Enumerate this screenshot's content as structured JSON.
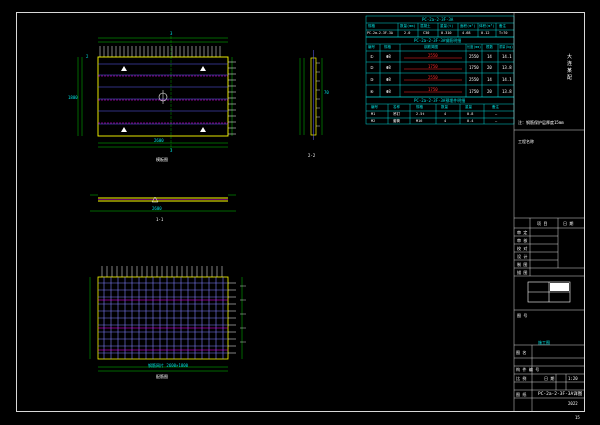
{
  "drawing": {
    "colors": {
      "background": "#000000",
      "frame": "#d8d8d8",
      "cyan": "#00e5e5",
      "yellow": "#ffff00",
      "green": "#00ff00",
      "blue": "#4040ff",
      "magenta": "#ff00ff",
      "red": "#ff2a2a",
      "white": "#ffffff"
    },
    "top_view": {
      "dim_top": "3",
      "dim_left": "2",
      "dim_bottom": "3",
      "dim_width": "2600",
      "dim_height": "1800",
      "caption": "模板图"
    },
    "side_view": {
      "caption": "2-2",
      "dim": "70"
    },
    "section_view": {
      "caption": "1-1",
      "dim": "2600"
    },
    "rebar_view": {
      "caption": "配筋图",
      "inner_label": "钢筋网片 2600×1800"
    },
    "summary_table": {
      "title": "PC-2a-2-3F-3A",
      "headers": [
        "规格",
        "数量(mm)",
        "混凝土",
        "重量(t)",
        "面积(m²)",
        "体积(m³)",
        "备注"
      ],
      "row": [
        "PC-2a-2-3F-3A",
        "2.0",
        "C30",
        "0.310",
        "4.68",
        "0.12",
        "T=70"
      ]
    },
    "rebar_table": {
      "title": "PC-2a-2-3F-3A钢筋明细",
      "headers": [
        "编号",
        "规格",
        "钢筋简图",
        "长度(mm)",
        "根数",
        "重量(kg)"
      ],
      "rows": [
        {
          "no": "①",
          "spec": "Φ8",
          "shape": "2550",
          "len": "2550",
          "count": "14",
          "weight": "14.1"
        },
        {
          "no": "②",
          "spec": "Φ8",
          "shape": "1750",
          "len": "1750",
          "count": "20",
          "weight": "13.8"
        },
        {
          "no": "③",
          "spec": "Φ8",
          "shape": "2550",
          "len": "2550",
          "count": "14",
          "weight": "14.1"
        },
        {
          "no": "④",
          "spec": "Φ8",
          "shape": "1750",
          "len": "1750",
          "count": "20",
          "weight": "13.8"
        }
      ]
    },
    "embed_table": {
      "title": "PC-2a-2-3F-3A预埋件明细",
      "headers": [
        "编号",
        "名称",
        "规格",
        "数量",
        "重量",
        "备注"
      ],
      "rows": [
        [
          "M1",
          "吊钉",
          "2.5t",
          "4",
          "0.8",
          "—"
        ],
        [
          "M2",
          "套筒",
          "M16",
          "4",
          "0.4",
          "—"
        ]
      ]
    },
    "note": "注：钢筋保护层厚度15mm",
    "title_block": {
      "side_title": "大 连 某 配",
      "project_label": "工程名称",
      "rows": [
        "审 定",
        "审 核",
        "校 对",
        "设 计",
        "制 图",
        "描 图"
      ],
      "top_row": [
        "项 目",
        "日 期"
      ],
      "drawing_no_label": "图 号",
      "drawing_name_label": "图 名",
      "component_label": "构 件 编 号",
      "scale_label": "比 例",
      "scale_value": "1:20",
      "drawing_label": "图 纸",
      "drawing_code": "PC-2a-2-3F-3A详图",
      "date_label": "日 期",
      "date_value": "2022",
      "phase_label": "施工图",
      "page": "15"
    }
  }
}
